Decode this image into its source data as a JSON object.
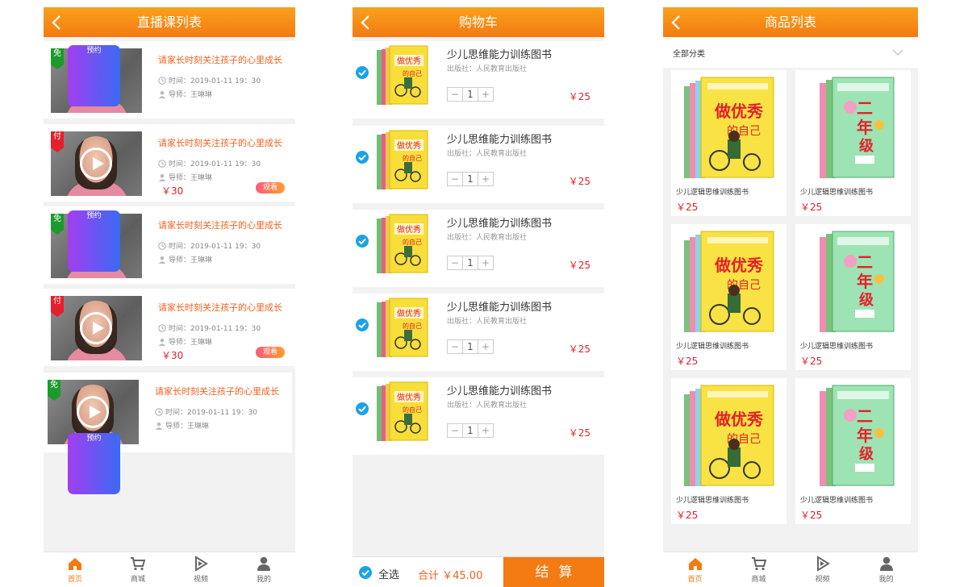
{
  "live": {
    "title": "直播课列表",
    "items": [
      {
        "flag": "免",
        "flag_type": "free",
        "title": "请家长时刻关注孩子的心里成长",
        "time": "时间：2019-01-11  19：30",
        "teacher": "导师：王琳琳",
        "price": "",
        "button": "预约",
        "button_type": "book"
      },
      {
        "flag": "付",
        "flag_type": "paid",
        "title": "请家长时刻关注孩子的心里成长",
        "time": "时间：2019-01-11  19：30",
        "teacher": "导师：王琳琳",
        "price": "￥30",
        "button": "观看",
        "button_type": "watch"
      },
      {
        "flag": "免",
        "flag_type": "free",
        "title": "请家长时刻关注孩子的心里成长",
        "time": "时间：2019-01-11  19：30",
        "teacher": "导师：王琳琳",
        "price": "",
        "button": "预约",
        "button_type": "book"
      },
      {
        "flag": "付",
        "flag_type": "paid",
        "title": "请家长时刻关注孩子的心里成长",
        "time": "时间：2019-01-11  19：30",
        "teacher": "导师：王琳琳",
        "price": "￥30",
        "button": "观看",
        "button_type": "watch"
      },
      {
        "flag": "免",
        "flag_type": "free",
        "title": "请家长时刻关注孩子的心里成长",
        "time": "时间：2019-01-11  19：30",
        "teacher": "导师：王琳琳",
        "price": "",
        "button": "预约",
        "button_type": "book"
      }
    ]
  },
  "cart": {
    "title": "购物车",
    "items": [
      {
        "name": "少儿思维能力训练图书",
        "publisher": "出版社：人民教育出版社",
        "qty": "1",
        "price": "￥25"
      },
      {
        "name": "少儿思维能力训练图书",
        "publisher": "出版社：人民教育出版社",
        "qty": "1",
        "price": "￥25"
      },
      {
        "name": "少儿思维能力训练图书",
        "publisher": "出版社：人民教育出版社",
        "qty": "1",
        "price": "￥25"
      },
      {
        "name": "少儿思维能力训练图书",
        "publisher": "出版社：人民教育出版社",
        "qty": "1",
        "price": "￥25"
      },
      {
        "name": "少儿思维能力训练图书",
        "publisher": "出版社：人民教育出版社",
        "qty": "1",
        "price": "￥25"
      }
    ],
    "select_all": "全选",
    "total": "合计 ￥45.00",
    "checkout": "结算"
  },
  "goods": {
    "title": "商品列表",
    "category": "全部分类",
    "items": [
      {
        "name": "少儿逻辑思维训练图书",
        "price": "￥25",
        "cover": "yellow"
      },
      {
        "name": "少儿逻辑思维训练图书",
        "price": "￥25",
        "cover": "green"
      },
      {
        "name": "少儿逻辑思维训练图书",
        "price": "￥25",
        "cover": "yellow"
      },
      {
        "name": "少儿逻辑思维训练图书",
        "price": "￥25",
        "cover": "green"
      },
      {
        "name": "少儿逻辑思维训练图书",
        "price": "￥25",
        "cover": "yellow"
      },
      {
        "name": "少儿逻辑思维训练图书",
        "price": "￥25",
        "cover": "green"
      }
    ]
  },
  "tabbar": [
    {
      "label": "首页",
      "icon": "home-icon",
      "active": true
    },
    {
      "label": "商城",
      "icon": "cart-icon",
      "active": false
    },
    {
      "label": "视频",
      "icon": "video-icon",
      "active": false
    },
    {
      "label": "我的",
      "icon": "user-icon",
      "active": false
    }
  ],
  "colors": {
    "accent": "#f47a12",
    "price": "#e5202a",
    "check": "#1aa3e8"
  }
}
